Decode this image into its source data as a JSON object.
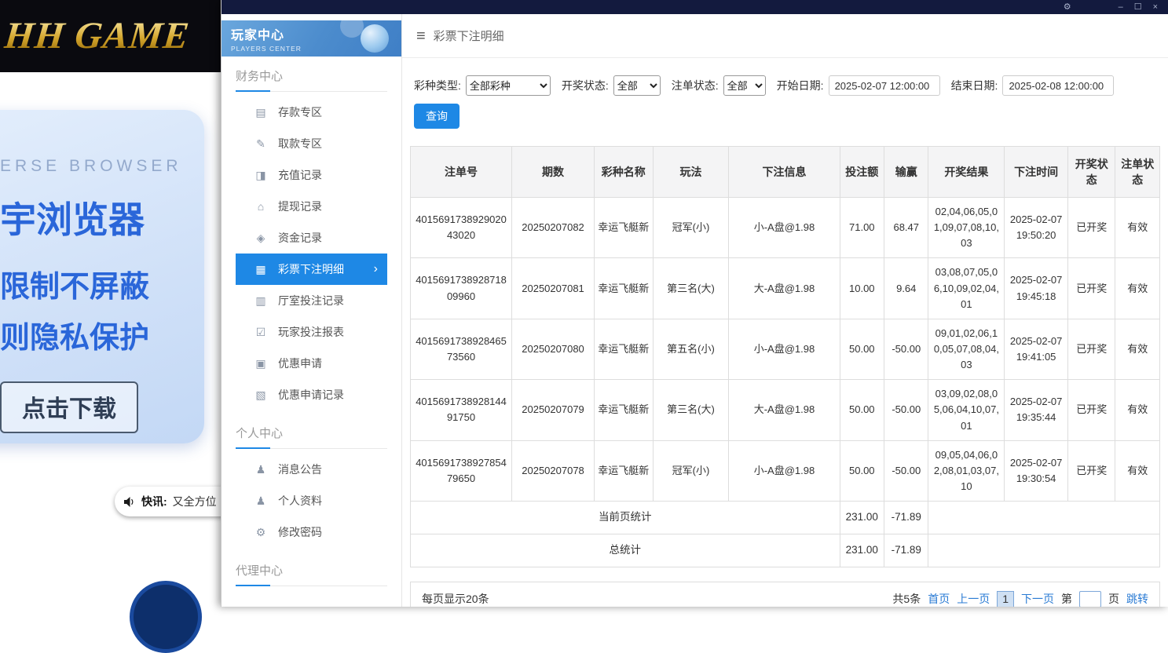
{
  "icons": {
    "hamburger": "≡",
    "chevron_right": "›",
    "gear": "⚙",
    "minimize": "–",
    "maximize": "☐",
    "close": "×"
  },
  "background": {
    "logo": "HH GAME",
    "promo": {
      "tagline": "ERSE BROWSER",
      "line1": "宇浏览器",
      "line2": "限制不屏蔽",
      "line3": "则隐私保护",
      "download": "点击下载"
    },
    "ticker": {
      "label": "快讯:",
      "text": "又全方位"
    }
  },
  "sidebar": {
    "title": "玩家中心",
    "subtitle": "PLAYERS CENTER",
    "sections": [
      {
        "label": "财务中心",
        "items": [
          {
            "label": "存款专区",
            "icon": "▤"
          },
          {
            "label": "取款专区",
            "icon": "✎"
          },
          {
            "label": "充值记录",
            "icon": "◨"
          },
          {
            "label": "提现记录",
            "icon": "⌂"
          },
          {
            "label": "资金记录",
            "icon": "◈"
          },
          {
            "label": "彩票下注明细",
            "icon": "▦"
          },
          {
            "label": "厅室投注记录",
            "icon": "▥"
          },
          {
            "label": "玩家投注报表",
            "icon": "☑"
          },
          {
            "label": "优惠申请",
            "icon": "▣"
          },
          {
            "label": "优惠申请记录",
            "icon": "▧"
          }
        ]
      },
      {
        "label": "个人中心",
        "items": [
          {
            "label": "消息公告",
            "icon": "♟"
          },
          {
            "label": "个人资料",
            "icon": "♟"
          },
          {
            "label": "修改密码",
            "icon": "⚙"
          }
        ]
      },
      {
        "label": "代理中心",
        "items": []
      }
    ]
  },
  "header": {
    "title": "彩票下注明细"
  },
  "filters": {
    "lottery_type_label": "彩种类型:",
    "lottery_type_value": "全部彩种",
    "draw_status_label": "开奖状态:",
    "draw_status_value": "全部",
    "order_status_label": "注单状态:",
    "order_status_value": "全部",
    "start_date_label": "开始日期:",
    "start_date_value": "2025-02-07 12:00:00",
    "end_date_label": "结束日期:",
    "end_date_value": "2025-02-08 12:00:00",
    "search_button": "查询"
  },
  "table": {
    "headers": [
      "注单号",
      "期数",
      "彩种名称",
      "玩法",
      "下注信息",
      "投注额",
      "输赢",
      "开奖结果",
      "下注时间",
      "开奖状态",
      "注单状态"
    ],
    "rows": [
      {
        "order_no": "401569173892902043020",
        "period": "20250207082",
        "lottery": "幸运飞艇新",
        "play": "冠军(小)",
        "bet_info": "小-A盘@1.98",
        "amount": "71.00",
        "win_loss": "68.47",
        "result": "02,04,06,05,01,09,07,08,10,03",
        "bet_time": "2025-02-07 19:50:20",
        "draw_status": "已开奖",
        "order_status": "有效"
      },
      {
        "order_no": "401569173892871809960",
        "period": "20250207081",
        "lottery": "幸运飞艇新",
        "play": "第三名(大)",
        "bet_info": "大-A盘@1.98",
        "amount": "10.00",
        "win_loss": "9.64",
        "result": "03,08,07,05,06,10,09,02,04,01",
        "bet_time": "2025-02-07 19:45:18",
        "draw_status": "已开奖",
        "order_status": "有效"
      },
      {
        "order_no": "401569173892846573560",
        "period": "20250207080",
        "lottery": "幸运飞艇新",
        "play": "第五名(小)",
        "bet_info": "小-A盘@1.98",
        "amount": "50.00",
        "win_loss": "-50.00",
        "result": "09,01,02,06,10,05,07,08,04,03",
        "bet_time": "2025-02-07 19:41:05",
        "draw_status": "已开奖",
        "order_status": "有效"
      },
      {
        "order_no": "401569173892814491750",
        "period": "20250207079",
        "lottery": "幸运飞艇新",
        "play": "第三名(大)",
        "bet_info": "大-A盘@1.98",
        "amount": "50.00",
        "win_loss": "-50.00",
        "result": "03,09,02,08,05,06,04,10,07,01",
        "bet_time": "2025-02-07 19:35:44",
        "draw_status": "已开奖",
        "order_status": "有效"
      },
      {
        "order_no": "401569173892785479650",
        "period": "20250207078",
        "lottery": "幸运飞艇新",
        "play": "冠军(小)",
        "bet_info": "小-A盘@1.98",
        "amount": "50.00",
        "win_loss": "-50.00",
        "result": "09,05,04,06,02,08,01,03,07,10",
        "bet_time": "2025-02-07 19:30:54",
        "draw_status": "已开奖",
        "order_status": "有效"
      }
    ],
    "summary": [
      {
        "label": "当前页统计",
        "amount": "231.00",
        "win_loss": "-71.89"
      },
      {
        "label": "总统计",
        "amount": "231.00",
        "win_loss": "-71.89"
      }
    ]
  },
  "pagination": {
    "per_page": "每页显示20条",
    "total": "共5条",
    "first": "首页",
    "prev": "上一页",
    "current": "1",
    "next": "下一页",
    "page_prefix": "第",
    "page_suffix": "页",
    "jump": "跳转"
  }
}
